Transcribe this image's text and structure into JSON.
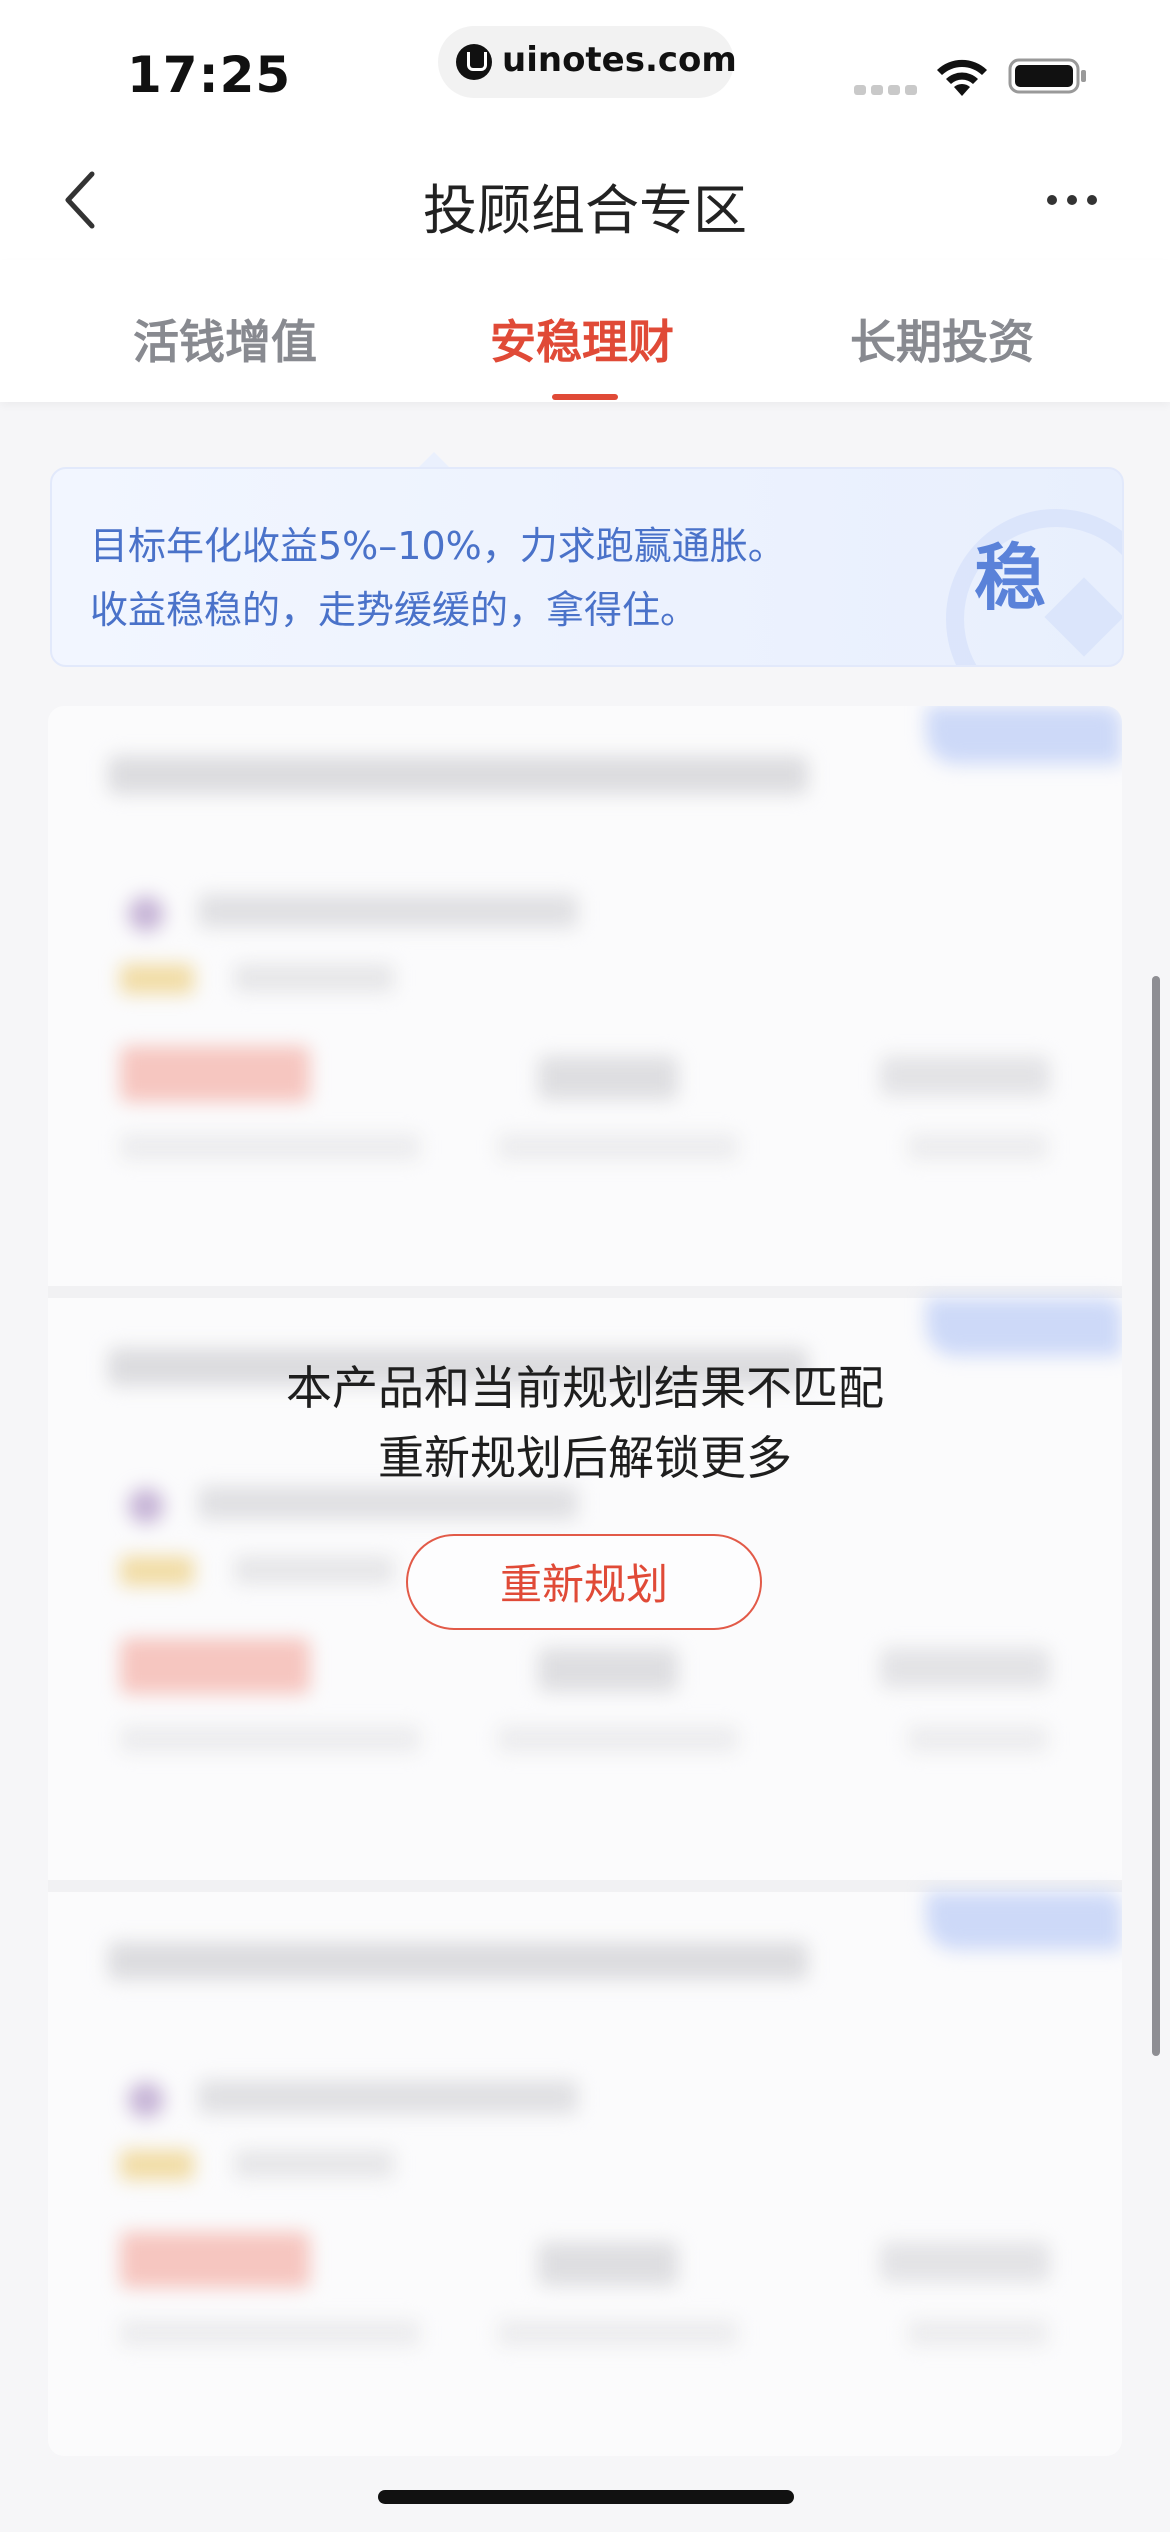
{
  "status_bar": {
    "time": "17:25",
    "url": "uinotes.com"
  },
  "nav": {
    "title": "投顾组合专区"
  },
  "tabs": [
    {
      "label": "活钱增值",
      "active": false
    },
    {
      "label": "安稳理财",
      "active": true
    },
    {
      "label": "长期投资",
      "active": false
    }
  ],
  "banner": {
    "line1": "目标年化收益5%–10%，力求跑赢通胀。",
    "line2": "收益稳稳的，走势缓缓的，拿得住。",
    "badge": "稳"
  },
  "lock_notice": {
    "line1": "本产品和当前规划结果不匹配",
    "line2": "重新规划后解锁更多",
    "button_label": "重新规划"
  },
  "colors": {
    "accent": "#e04a37",
    "banner_text": "#4a72c9",
    "banner_bg": "#eef3fe"
  }
}
